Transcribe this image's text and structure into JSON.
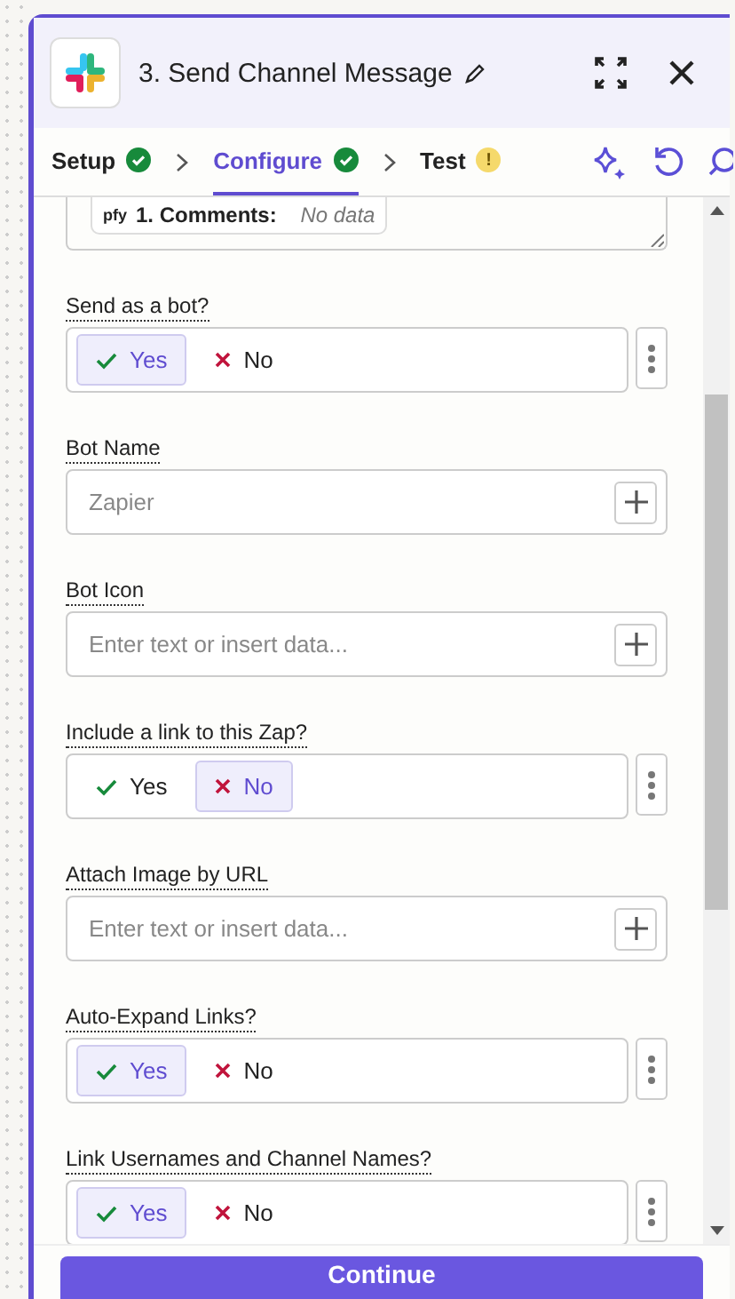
{
  "header": {
    "title": "3. Send Channel Message"
  },
  "tabs": [
    {
      "label": "Setup",
      "selected": false,
      "kind": "done"
    },
    {
      "label": "Configure",
      "selected": true,
      "kind": "done"
    },
    {
      "label": "Test",
      "selected": false,
      "kind": "warning",
      "badge": "!"
    }
  ],
  "comments_field": {
    "pill_icon": "pfy",
    "pill_label": "1. Comments:",
    "pill_value": "No data"
  },
  "fields": [
    {
      "kind": "toggle",
      "label": "Send as a bot?",
      "options": [
        {
          "label": "Yes",
          "kind": "yes",
          "selected": true
        },
        {
          "label": "No",
          "kind": "no",
          "selected": false
        }
      ]
    },
    {
      "kind": "text",
      "label": "Bot Name",
      "placeholder": "Zapier"
    },
    {
      "kind": "text",
      "label": "Bot Icon",
      "placeholder": "Enter text or insert data..."
    },
    {
      "kind": "toggle",
      "label": "Include a link to this Zap?",
      "options": [
        {
          "label": "Yes",
          "kind": "yes",
          "selected": false
        },
        {
          "label": "No",
          "kind": "no",
          "selected": true
        }
      ]
    },
    {
      "kind": "text",
      "label": "Attach Image by URL",
      "placeholder": "Enter text or insert data..."
    },
    {
      "kind": "toggle",
      "label": "Auto-Expand Links?",
      "options": [
        {
          "label": "Yes",
          "kind": "yes",
          "selected": true
        },
        {
          "label": "No",
          "kind": "no",
          "selected": false
        }
      ]
    },
    {
      "kind": "toggle",
      "label": "Link Usernames and Channel Names?",
      "options": [
        {
          "label": "Yes",
          "kind": "yes",
          "selected": true
        },
        {
          "label": "No",
          "kind": "no",
          "selected": false
        }
      ]
    }
  ],
  "footer": {
    "button": "Continue"
  }
}
